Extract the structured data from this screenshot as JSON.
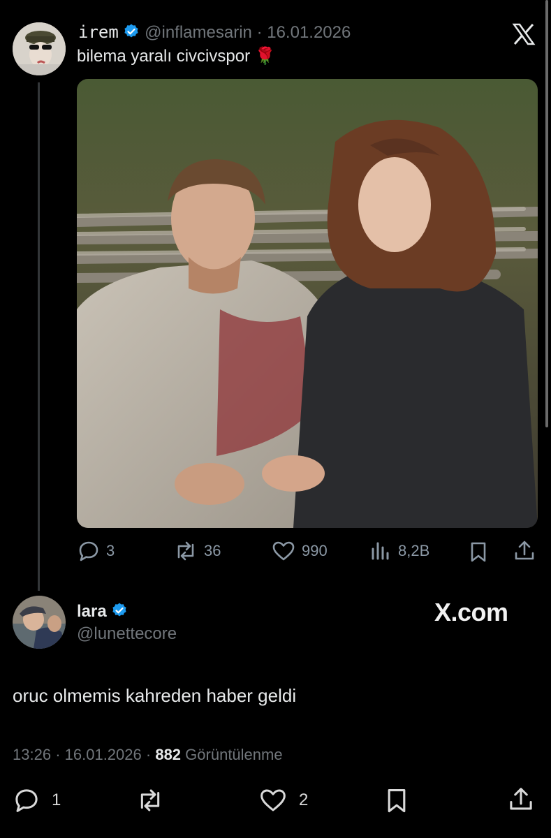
{
  "quoted_tweet": {
    "display_name": "irem",
    "handle": "@inflamesarin",
    "separator": "·",
    "date": "16.01.2026",
    "text": "bilema yaralı civcivspor 🌹",
    "actions": {
      "replies": "3",
      "reposts": "36",
      "likes": "990",
      "views": "8,2B"
    }
  },
  "main_tweet": {
    "display_name": "lara",
    "handle": "@lunettecore",
    "text": "oruc olmemis kahreden haber geldi",
    "time": "13:26",
    "separator": "·",
    "date": "16.01.2026",
    "views_count": "882",
    "views_label": "Görüntülenme",
    "actions": {
      "replies": "1",
      "reposts": "",
      "likes": "2"
    }
  },
  "branding": {
    "x_com_label": "X.com"
  },
  "colors": {
    "background": "#000000",
    "verified": "#1d9bf0",
    "muted": "#71767b"
  }
}
